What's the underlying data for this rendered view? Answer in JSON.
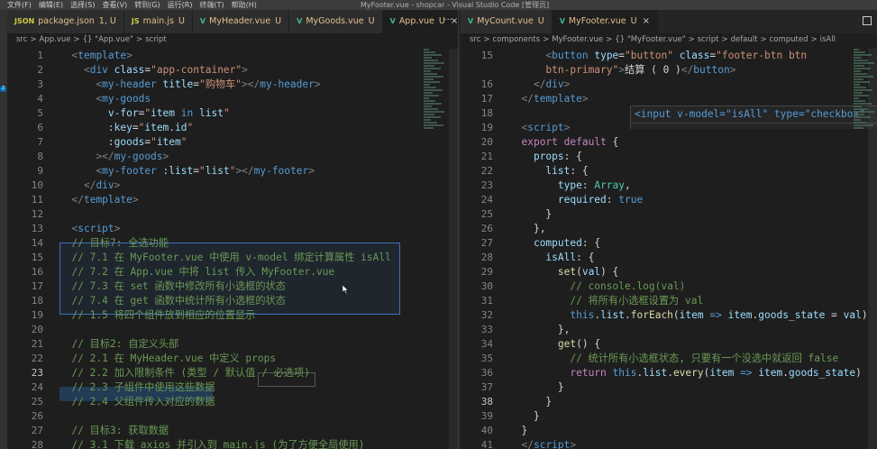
{
  "window": {
    "title": "MyFooter.vue - shopcar - Visual Studio Code [管理员]",
    "menu": [
      "文件(F)",
      "编辑(E)",
      "选择(S)",
      "查看(V)",
      "转到(G)",
      "运行(R)",
      "终端(T)",
      "帮助(H)"
    ]
  },
  "left": {
    "tabs": [
      {
        "icon": "JSON",
        "icon_kind": "json",
        "label": "package.json",
        "status": "1, U",
        "active": false
      },
      {
        "icon": "JS",
        "icon_kind": "js",
        "label": "main.js",
        "status": "U",
        "active": false
      },
      {
        "icon": "V",
        "icon_kind": "vue",
        "label": "MyHeader.vue",
        "status": "U",
        "active": false
      },
      {
        "icon": "V",
        "icon_kind": "vue",
        "label": "MyGoods.vue",
        "status": "U",
        "active": false
      },
      {
        "icon": "V",
        "icon_kind": "vue",
        "label": "App.vue",
        "status": "U",
        "active": true,
        "close": "×"
      }
    ],
    "more": "···",
    "breadcrumb": [
      "src",
      "App.vue",
      "{} \"App.vue\"",
      "script"
    ],
    "lines": [
      {
        "n": "1",
        "tokens": [
          [
            "  ",
            "ws"
          ],
          [
            "<",
            "tagp"
          ],
          [
            "template",
            "tag"
          ],
          [
            ">",
            "tagp"
          ]
        ]
      },
      {
        "n": "2",
        "tokens": [
          [
            "    ",
            "ws"
          ],
          [
            "<",
            "tagp"
          ],
          [
            "div",
            "tag"
          ],
          [
            " ",
            "ws"
          ],
          [
            "class",
            "attr"
          ],
          [
            "=",
            "plain"
          ],
          [
            "\"app-container\"",
            "str"
          ],
          [
            ">",
            "tagp"
          ]
        ]
      },
      {
        "n": "3",
        "tokens": [
          [
            "      ",
            "ws"
          ],
          [
            "<",
            "tagp"
          ],
          [
            "my-header",
            "tag"
          ],
          [
            " ",
            "ws"
          ],
          [
            "title",
            "attr"
          ],
          [
            "=",
            "plain"
          ],
          [
            "\"购物车\"",
            "str"
          ],
          [
            "></",
            "tagp"
          ],
          [
            "my-header",
            "tag"
          ],
          [
            ">",
            "tagp"
          ]
        ]
      },
      {
        "n": "4",
        "tokens": [
          [
            "      ",
            "ws"
          ],
          [
            "<",
            "tagp"
          ],
          [
            "my-goods",
            "tag"
          ]
        ]
      },
      {
        "n": "5",
        "tokens": [
          [
            "        ",
            "ws"
          ],
          [
            "v-for",
            "attr"
          ],
          [
            "=",
            "plain"
          ],
          [
            "\"",
            "str"
          ],
          [
            "item",
            "prop"
          ],
          [
            " in ",
            "kw"
          ],
          [
            "list",
            "prop"
          ],
          [
            "\"",
            "str"
          ]
        ]
      },
      {
        "n": "6",
        "tokens": [
          [
            "        ",
            "ws"
          ],
          [
            ":key",
            "attr"
          ],
          [
            "=",
            "plain"
          ],
          [
            "\"",
            "str"
          ],
          [
            "item.id",
            "prop"
          ],
          [
            "\"",
            "str"
          ]
        ]
      },
      {
        "n": "7",
        "tokens": [
          [
            "        ",
            "ws"
          ],
          [
            ":goods",
            "attr"
          ],
          [
            "=",
            "plain"
          ],
          [
            "\"",
            "str"
          ],
          [
            "item",
            "prop"
          ],
          [
            "\"",
            "str"
          ]
        ]
      },
      {
        "n": "8",
        "tokens": [
          [
            "      ",
            "ws"
          ],
          [
            "></",
            "tagp"
          ],
          [
            "my-goods",
            "tag"
          ],
          [
            ">",
            "tagp"
          ]
        ]
      },
      {
        "n": "9",
        "tokens": [
          [
            "      ",
            "ws"
          ],
          [
            "<",
            "tagp"
          ],
          [
            "my-footer",
            "tag"
          ],
          [
            " ",
            "ws"
          ],
          [
            ":list",
            "attr"
          ],
          [
            "=",
            "plain"
          ],
          [
            "\"",
            "str"
          ],
          [
            "list",
            "prop"
          ],
          [
            "\"",
            "str"
          ],
          [
            "></",
            "tagp"
          ],
          [
            "my-footer",
            "tag"
          ],
          [
            ">",
            "tagp"
          ]
        ]
      },
      {
        "n": "10",
        "tokens": [
          [
            "    ",
            "ws"
          ],
          [
            "</",
            "tagp"
          ],
          [
            "div",
            "tag"
          ],
          [
            ">",
            "tagp"
          ]
        ]
      },
      {
        "n": "11",
        "tokens": [
          [
            "  ",
            "ws"
          ],
          [
            "</",
            "tagp"
          ],
          [
            "template",
            "tag"
          ],
          [
            ">",
            "tagp"
          ]
        ]
      },
      {
        "n": "12",
        "tokens": []
      },
      {
        "n": "13",
        "tokens": [
          [
            "  ",
            "ws"
          ],
          [
            "<",
            "tagp"
          ],
          [
            "script",
            "tag"
          ],
          [
            ">",
            "tagp"
          ]
        ]
      },
      {
        "n": "14",
        "tokens": [
          [
            "  // 目标7: 全选功能",
            "cmt"
          ]
        ]
      },
      {
        "n": "15",
        "tokens": [
          [
            "  // 7.1 在 MyFooter.vue 中使用 v-model 绑定计算属性 isAll",
            "cmt"
          ]
        ]
      },
      {
        "n": "16",
        "tokens": [
          [
            "  // 7.2 在 App.vue 中将 list 传入 MyFooter.vue",
            "cmt"
          ]
        ]
      },
      {
        "n": "17",
        "tokens": [
          [
            "  // 7.3 在 set 函数中修改所有小选框的状态",
            "cmt"
          ]
        ]
      },
      {
        "n": "18",
        "tokens": [
          [
            "  // 7.4 在 get 函数中统计所有小选框的状态",
            "cmt"
          ]
        ]
      },
      {
        "n": "19",
        "tokens": [
          [
            "  // 1.5 将四个组件放到相应的位置显示",
            "cmt"
          ]
        ]
      },
      {
        "n": "20",
        "tokens": []
      },
      {
        "n": "21",
        "tokens": [
          [
            "  // 目标2: 自定义头部",
            "cmt"
          ]
        ]
      },
      {
        "n": "22",
        "tokens": [
          [
            "  // 2.1 在 MyHeader.vue 中定义 props",
            "cmt"
          ]
        ]
      },
      {
        "n": "23",
        "tokens": [
          [
            "  // 2.2 加入限制条件 (类型 / 默认值 / 必选项)",
            "cmt"
          ]
        ],
        "current": true
      },
      {
        "n": "24",
        "tokens": [
          [
            "  // 2.3 子组件中使用这些数据",
            "cmt"
          ]
        ]
      },
      {
        "n": "25",
        "tokens": [
          [
            "  // 2.4 父组件传入对应的数据",
            "cmt"
          ]
        ]
      },
      {
        "n": "26",
        "tokens": []
      },
      {
        "n": "27",
        "tokens": [
          [
            "  // 目标3: 获取数据",
            "cmt"
          ]
        ]
      },
      {
        "n": "28",
        "tokens": [
          [
            "  // 3.1 下载 axios 并引入到 main.js (为了方便全局使用)",
            "cmt"
          ]
        ]
      }
    ]
  },
  "right": {
    "tabs": [
      {
        "icon": "V",
        "icon_kind": "vue",
        "label": "MyCount.vue",
        "status": "U",
        "active": false
      },
      {
        "icon": "V",
        "icon_kind": "vue",
        "label": "MyFooter.vue",
        "status": "U",
        "active": true,
        "close": "×"
      }
    ],
    "breadcrumb": [
      "src",
      "components",
      "MyFooter.vue",
      "{} \"MyFooter.vue\"",
      "script",
      "default",
      "computed",
      "isAll"
    ],
    "hover": "<input v-model=\"isAll\" type=\"checkbox\"",
    "lines": [
      {
        "n": "15",
        "tokens": [
          [
            "      ",
            "ws"
          ],
          [
            "<",
            "tagp"
          ],
          [
            "button",
            "tag"
          ],
          [
            " ",
            "ws"
          ],
          [
            "type",
            "attr"
          ],
          [
            "=",
            "plain"
          ],
          [
            "\"button\"",
            "str"
          ],
          [
            " ",
            "ws"
          ],
          [
            "class",
            "attr"
          ],
          [
            "=",
            "plain"
          ],
          [
            "\"footer-btn btn",
            "str"
          ]
        ]
      },
      {
        "n": "",
        "tokens": [
          [
            "      ",
            "ws"
          ],
          [
            "btn-primary\"",
            "str"
          ],
          [
            ">",
            "tagp"
          ],
          [
            "结算 ( 0 )",
            "plain"
          ],
          [
            "</",
            "tagp"
          ],
          [
            "button",
            "tag"
          ],
          [
            ">",
            "tagp"
          ]
        ]
      },
      {
        "n": "16",
        "tokens": [
          [
            "    ",
            "ws"
          ],
          [
            "</",
            "tagp"
          ],
          [
            "div",
            "tag"
          ],
          [
            ">",
            "tagp"
          ]
        ]
      },
      {
        "n": "17",
        "tokens": [
          [
            "  ",
            "ws"
          ],
          [
            "</",
            "tagp"
          ],
          [
            "template",
            "tag"
          ],
          [
            ">",
            "tagp"
          ]
        ]
      },
      {
        "n": "18",
        "tokens": []
      },
      {
        "n": "19",
        "tokens": [
          [
            "  ",
            "ws"
          ],
          [
            "<",
            "tagp"
          ],
          [
            "script",
            "tag"
          ],
          [
            ">",
            "tagp"
          ]
        ]
      },
      {
        "n": "20",
        "tokens": [
          [
            "  ",
            "ws"
          ],
          [
            "export",
            "kw2"
          ],
          [
            " ",
            "ws"
          ],
          [
            "default",
            "kw2"
          ],
          [
            " {",
            "plain"
          ]
        ]
      },
      {
        "n": "21",
        "tokens": [
          [
            "    ",
            "ws"
          ],
          [
            "props",
            "prop"
          ],
          [
            ": {",
            "plain"
          ]
        ]
      },
      {
        "n": "22",
        "tokens": [
          [
            "      ",
            "ws"
          ],
          [
            "list",
            "prop"
          ],
          [
            ": {",
            "plain"
          ]
        ]
      },
      {
        "n": "23",
        "tokens": [
          [
            "        ",
            "ws"
          ],
          [
            "type",
            "prop"
          ],
          [
            ": ",
            "plain"
          ],
          [
            "Array",
            "type"
          ],
          [
            ",",
            "plain"
          ]
        ]
      },
      {
        "n": "24",
        "tokens": [
          [
            "        ",
            "ws"
          ],
          [
            "required",
            "prop"
          ],
          [
            ": ",
            "plain"
          ],
          [
            "true",
            "kw"
          ]
        ]
      },
      {
        "n": "25",
        "tokens": [
          [
            "      ",
            "ws"
          ],
          [
            "}",
            "plain"
          ]
        ]
      },
      {
        "n": "26",
        "tokens": [
          [
            "    ",
            "ws"
          ],
          [
            "},",
            "plain"
          ]
        ]
      },
      {
        "n": "27",
        "tokens": [
          [
            "    ",
            "ws"
          ],
          [
            "computed",
            "prop"
          ],
          [
            ": {",
            "plain"
          ]
        ]
      },
      {
        "n": "28",
        "tokens": [
          [
            "      ",
            "ws"
          ],
          [
            "isAll",
            "prop"
          ],
          [
            ": {",
            "plain"
          ]
        ]
      },
      {
        "n": "29",
        "tokens": [
          [
            "        ",
            "ws"
          ],
          [
            "set",
            "fn"
          ],
          [
            "(",
            "plain"
          ],
          [
            "val",
            "prop"
          ],
          [
            ") {",
            "plain"
          ]
        ]
      },
      {
        "n": "30",
        "tokens": [
          [
            "          // console.log(val)",
            "cmt"
          ]
        ]
      },
      {
        "n": "31",
        "tokens": [
          [
            "          // 将所有小选框设置为 val",
            "cmt"
          ]
        ]
      },
      {
        "n": "32",
        "tokens": [
          [
            "          ",
            "ws"
          ],
          [
            "this",
            "kw"
          ],
          [
            ".",
            "plain"
          ],
          [
            "list",
            "prop"
          ],
          [
            ".",
            "plain"
          ],
          [
            "forEach",
            "fn"
          ],
          [
            "(",
            "plain"
          ],
          [
            "item",
            "prop"
          ],
          [
            " => ",
            "kw"
          ],
          [
            "item",
            "prop"
          ],
          [
            ".",
            "plain"
          ],
          [
            "goods_state",
            "prop"
          ],
          [
            " = ",
            "plain"
          ],
          [
            "val",
            "prop"
          ],
          [
            ")",
            "plain"
          ]
        ]
      },
      {
        "n": "33",
        "tokens": [
          [
            "        ",
            "ws"
          ],
          [
            "},",
            "plain"
          ]
        ]
      },
      {
        "n": "34",
        "tokens": [
          [
            "        ",
            "ws"
          ],
          [
            "get",
            "fn"
          ],
          [
            "() {",
            "plain"
          ]
        ]
      },
      {
        "n": "35",
        "tokens": [
          [
            "          // 统计所有小选框状态, 只要有一个没选中就返回 false",
            "cmt"
          ]
        ]
      },
      {
        "n": "36",
        "tokens": [
          [
            "          ",
            "ws"
          ],
          [
            "return",
            "kw2"
          ],
          [
            " ",
            "ws"
          ],
          [
            "this",
            "kw"
          ],
          [
            ".",
            "plain"
          ],
          [
            "list",
            "prop"
          ],
          [
            ".",
            "plain"
          ],
          [
            "every",
            "fn"
          ],
          [
            "(",
            "plain"
          ],
          [
            "item",
            "prop"
          ],
          [
            " => ",
            "kw"
          ],
          [
            "item",
            "prop"
          ],
          [
            ".",
            "plain"
          ],
          [
            "goods_state",
            "prop"
          ],
          [
            ")",
            "plain"
          ]
        ]
      },
      {
        "n": "37",
        "tokens": [
          [
            "        ",
            "ws"
          ],
          [
            "}",
            "plain"
          ]
        ]
      },
      {
        "n": "38",
        "tokens": [
          [
            "      ",
            "ws"
          ],
          [
            "}",
            "plain"
          ]
        ],
        "current": true
      },
      {
        "n": "39",
        "tokens": [
          [
            "    ",
            "ws"
          ],
          [
            "}",
            "plain"
          ]
        ]
      },
      {
        "n": "40",
        "tokens": [
          [
            "  ",
            "ws"
          ],
          [
            "}",
            "plain"
          ]
        ]
      },
      {
        "n": "41",
        "tokens": [
          [
            "  ",
            "ws"
          ],
          [
            "</",
            "tagp"
          ],
          [
            "script",
            "tag"
          ],
          [
            ">",
            "tagp"
          ]
        ]
      }
    ]
  },
  "colors": {
    "selection_border": "#3f6fbf",
    "vue_icon": "#41b883",
    "modified_tab": "#e2c08d",
    "badge": "#007acc"
  },
  "activity": {
    "badge": "2"
  }
}
